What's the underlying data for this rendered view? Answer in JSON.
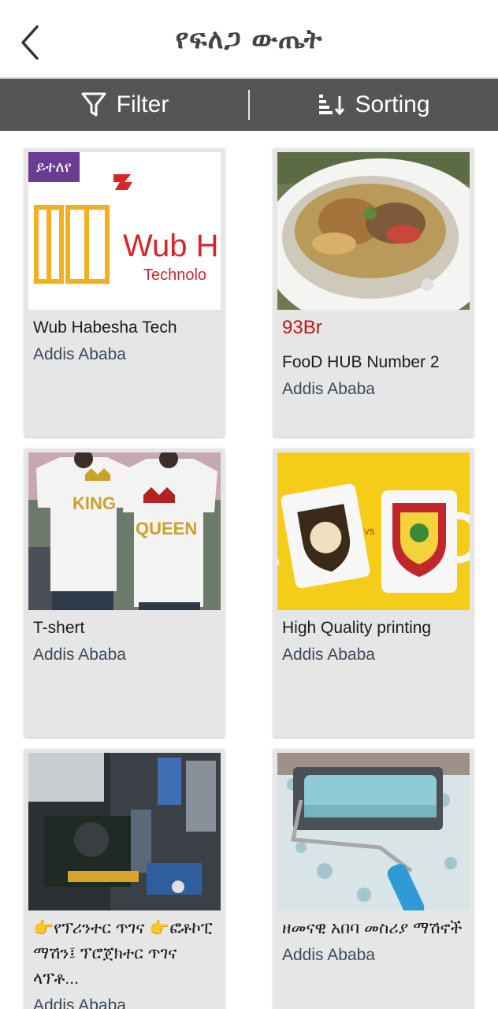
{
  "header": {
    "title": "የፍለጋ ውጤት",
    "back_icon": "chevron-left-icon"
  },
  "toolbar": {
    "filter_label": "Filter",
    "filter_icon": "funnel-icon",
    "sorting_label": "Sorting",
    "sorting_icon": "sort-icon"
  },
  "items": [
    {
      "badge": "ይተለየ",
      "price": "",
      "name": "Wub Habesha Tech",
      "city": "Addis Ababa",
      "logo_text": "Wub H",
      "logo_sub": "Technolo"
    },
    {
      "badge": "",
      "price": "93Br",
      "name": "FooD HUB Number 2",
      "city": "Addis Ababa"
    },
    {
      "badge": "",
      "price": "",
      "name": "T-shert",
      "city": "Addis Ababa",
      "shirt_left": "KING",
      "shirt_right": "QUEEN"
    },
    {
      "badge": "",
      "price": "",
      "name": "High Quality printing",
      "city": "Addis Ababa",
      "mug_vs": "VS"
    },
    {
      "badge": "",
      "price": "",
      "name": "👉የፕሪንተር ጥገና 👉ፎቶኮፒ ማሽን፤ ፕሮጀክተር ጥገና ላፕቶ...",
      "city": "Addis Ababa"
    },
    {
      "badge": "",
      "price": "",
      "name": "ዘመናዊ አበባ መስሪያ ማሽኖች",
      "city": "Addis Ababa"
    }
  ],
  "colors": {
    "toolbar_bg": "#555555",
    "badge_bg": "#6a3c94",
    "price": "#c01818",
    "city": "#3b4a5a"
  }
}
